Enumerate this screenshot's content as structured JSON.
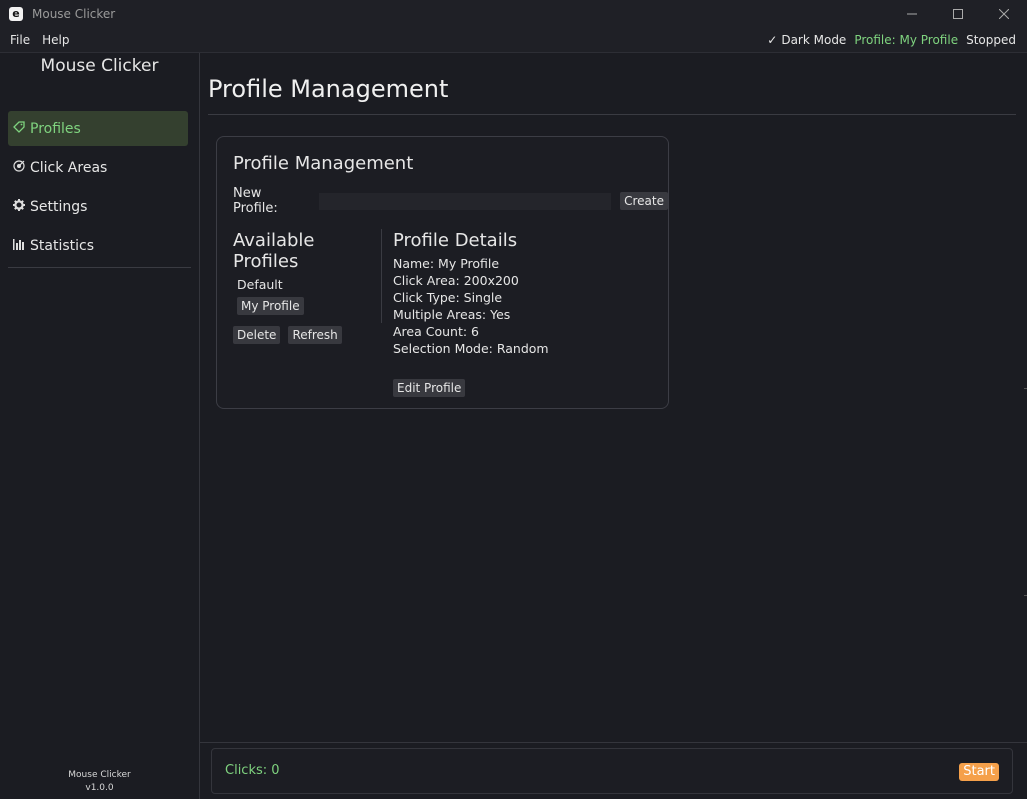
{
  "window": {
    "icon_letter": "e",
    "title": "Mouse Clicker",
    "controls": [
      "minimize-icon",
      "maximize-icon",
      "close-icon"
    ]
  },
  "menubar": {
    "items": [
      "File",
      "Help"
    ],
    "dark_mode": {
      "check": "✓",
      "label": "Dark Mode"
    },
    "profile_status": "Profile: My Profile",
    "run_status": "Stopped"
  },
  "sidebar": {
    "title": "Mouse Clicker",
    "items": [
      {
        "icon": "tag-icon",
        "label": "Profiles",
        "active": true
      },
      {
        "icon": "target-icon",
        "label": "Click Areas"
      },
      {
        "icon": "gear-icon",
        "label": "Settings"
      },
      {
        "icon": "bar-chart-icon",
        "label": "Statistics"
      }
    ],
    "footer_name": "Mouse Clicker",
    "footer_version": "v1.0.0"
  },
  "main": {
    "page_title": "Profile Management",
    "card": {
      "title": "Profile Management",
      "new_profile_label": "New Profile:",
      "new_profile_value": "",
      "create_label": "Create",
      "available_title": "Available Profiles",
      "profiles": [
        "Default",
        "My Profile"
      ],
      "delete_label": "Delete",
      "refresh_label": "Refresh",
      "details_title": "Profile Details",
      "details": [
        "Name: My Profile",
        "Click Area: 200x200",
        "Click Type: Single",
        "Multiple Areas: Yes",
        "Area Count: 6",
        "Selection Mode: Random"
      ],
      "edit_label": "Edit Profile"
    }
  },
  "footer": {
    "clicks": "Clicks: 0",
    "start_label": "Start"
  },
  "colors": {
    "background": "#1b1c22",
    "accent_green": "#7fd37f",
    "start_orange": "#f5a04a",
    "active_nav": "#34402f"
  }
}
